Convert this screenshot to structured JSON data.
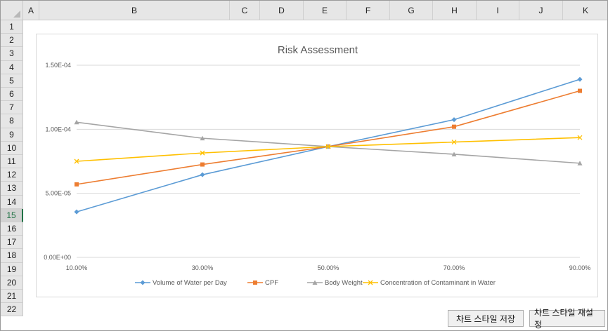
{
  "sheet": {
    "columns": [
      "A",
      "B",
      "C",
      "D",
      "E",
      "F",
      "G",
      "H",
      "I",
      "J",
      "K"
    ],
    "rows": [
      "1",
      "2",
      "3",
      "4",
      "5",
      "6",
      "7",
      "8",
      "9",
      "10",
      "11",
      "12",
      "13",
      "14",
      "15",
      "16",
      "17",
      "18",
      "19",
      "20",
      "21",
      "22"
    ],
    "selected_row": "15"
  },
  "chart_data": {
    "type": "line",
    "title": "Risk Assessment",
    "xlabel": "",
    "ylabel": "",
    "categories": [
      "10.00%",
      "30.00%",
      "50.00%",
      "70.00%",
      "90.00%"
    ],
    "y_tick_labels": [
      "0.00E+00",
      "5.00E-05",
      "1.00E-04",
      "1.50E-04"
    ],
    "ylim": [
      0,
      0.00015
    ],
    "grid": true,
    "legend_position": "bottom",
    "series": [
      {
        "name": "Volume of Water per Day",
        "values": [
          3.55e-05,
          6.45e-05,
          8.65e-05,
          0.0001075,
          0.000139
        ],
        "color": "#5b9bd5",
        "marker": "diamond"
      },
      {
        "name": "CPF",
        "values": [
          5.7e-05,
          7.25e-05,
          8.65e-05,
          0.000102,
          0.00013
        ],
        "color": "#ed7d31",
        "marker": "square"
      },
      {
        "name": "Body Weight",
        "values": [
          0.0001055,
          9.3e-05,
          8.65e-05,
          8.05e-05,
          7.35e-05
        ],
        "color": "#a5a5a5",
        "marker": "triangle"
      },
      {
        "name": "Concentration of Contaminant in Water",
        "values": [
          7.5e-05,
          8.15e-05,
          8.65e-05,
          9e-05,
          9.35e-05
        ],
        "color": "#ffc000",
        "marker": "x"
      }
    ]
  },
  "buttons": {
    "save_style": "차트 스타일 저장",
    "reset_style": "차트 스타일 재설정"
  }
}
